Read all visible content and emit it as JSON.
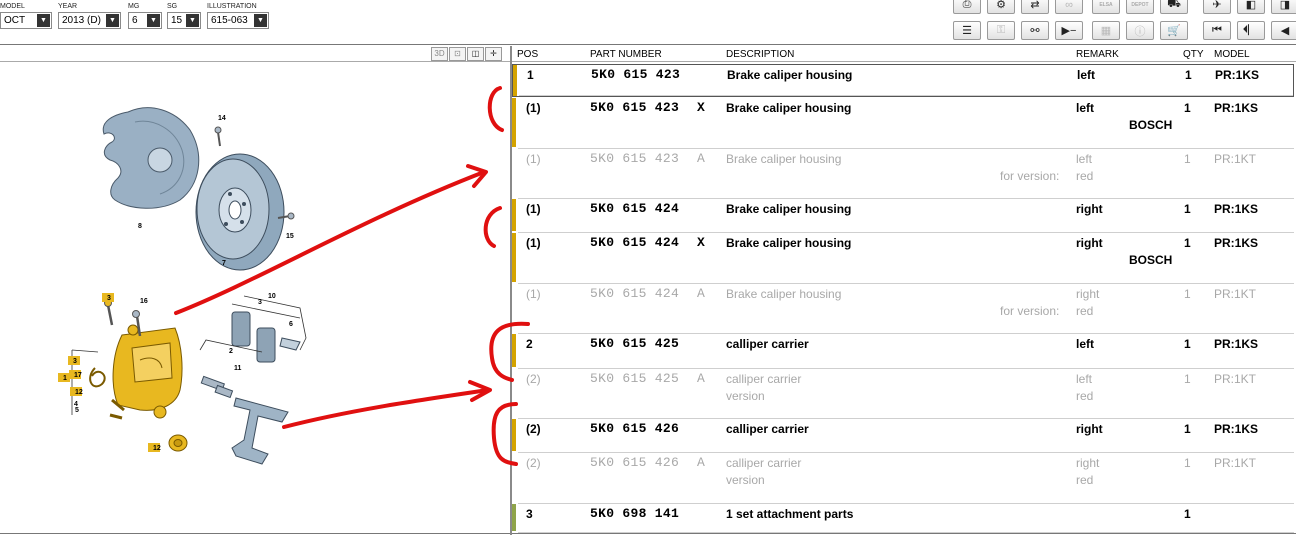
{
  "filters": [
    {
      "label": "MODEL",
      "value": "OCT"
    },
    {
      "label": "YEAR",
      "value": "2013 (D)"
    },
    {
      "label": "MG",
      "value": "6"
    },
    {
      "label": "SG",
      "value": "15"
    },
    {
      "label": "ILLUSTRATION",
      "value": "615-063"
    }
  ],
  "toolbar": {
    "elsa_label": "ELSA",
    "depot_label": "DEPOT"
  },
  "panel_buttons": {
    "three_d": "3D"
  },
  "table": {
    "headers": {
      "pos": "POS",
      "part_number": "PART NUMBER",
      "description": "DESCRIPTION",
      "remark": "REMARK",
      "qty": "QTY",
      "model": "MODEL"
    },
    "rows": [
      {
        "pos": "1",
        "part": "5K0 615 423",
        "suffix": "",
        "desc": "Brake caliper housing",
        "desc2": "",
        "remark": "left",
        "remark2": "",
        "note_label": "",
        "qty": "1",
        "model": "PR:1KS",
        "dim": false,
        "bar": "#d4a300"
      },
      {
        "pos": "(1)",
        "part": "5K0 615 423",
        "suffix": "X",
        "desc": "Brake caliper housing",
        "desc2": "",
        "remark": "left",
        "remark2": "BOSCH",
        "note_label": "",
        "qty": "1",
        "model": "PR:1KS",
        "dim": false,
        "bar": "#d4a300"
      },
      {
        "pos": "(1)",
        "part": "5K0 615 423",
        "suffix": "A",
        "desc": "Brake caliper housing",
        "desc2": "",
        "remark": "left",
        "remark2": "red",
        "note_label": "for version:",
        "qty": "1",
        "model": "PR:1KT",
        "dim": true,
        "bar": ""
      },
      {
        "pos": "(1)",
        "part": "5K0 615 424",
        "suffix": "",
        "desc": "Brake caliper housing",
        "desc2": "",
        "remark": "right",
        "remark2": "",
        "note_label": "",
        "qty": "1",
        "model": "PR:1KS",
        "dim": false,
        "bar": "#d4a300"
      },
      {
        "pos": "(1)",
        "part": "5K0 615 424",
        "suffix": "X",
        "desc": "Brake caliper housing",
        "desc2": "",
        "remark": "right",
        "remark2": "BOSCH",
        "note_label": "",
        "qty": "1",
        "model": "PR:1KS",
        "dim": false,
        "bar": "#d4a300"
      },
      {
        "pos": "(1)",
        "part": "5K0 615 424",
        "suffix": "A",
        "desc": "Brake caliper housing",
        "desc2": "",
        "remark": "right",
        "remark2": "red",
        "note_label": "for version:",
        "qty": "1",
        "model": "PR:1KT",
        "dim": true,
        "bar": ""
      },
      {
        "pos": "2",
        "part": "5K0 615 425",
        "suffix": "",
        "desc": "calliper carrier",
        "desc2": "",
        "remark": "left",
        "remark2": "",
        "note_label": "",
        "qty": "1",
        "model": "PR:1KS",
        "dim": false,
        "bar": "#d4a300"
      },
      {
        "pos": "(2)",
        "part": "5K0 615 425",
        "suffix": "A",
        "desc": "calliper carrier",
        "desc2": "version",
        "remark": "left",
        "remark2": "red",
        "note_label": "",
        "qty": "1",
        "model": "PR:1KT",
        "dim": true,
        "bar": ""
      },
      {
        "pos": "(2)",
        "part": "5K0 615 426",
        "suffix": "",
        "desc": "calliper carrier",
        "desc2": "",
        "remark": "right",
        "remark2": "",
        "note_label": "",
        "qty": "1",
        "model": "PR:1KS",
        "dim": false,
        "bar": "#d4a300"
      },
      {
        "pos": "(2)",
        "part": "5K0 615 426",
        "suffix": "A",
        "desc": "calliper carrier",
        "desc2": "version",
        "remark": "right",
        "remark2": "red",
        "note_label": "",
        "qty": "1",
        "model": "PR:1KT",
        "dim": true,
        "bar": ""
      },
      {
        "pos": "3",
        "part": "5K0 698 141",
        "suffix": "",
        "desc": "1 set attachment parts",
        "desc2": "",
        "remark": "",
        "remark2": "",
        "note_label": "",
        "qty": "1",
        "model": "",
        "dim": false,
        "bar": "#8fa44a"
      }
    ]
  },
  "illustration": {
    "callouts": [
      "14",
      "8",
      "7",
      "15",
      "3",
      "16",
      "10",
      "3",
      "6",
      "2",
      "11",
      "3",
      "17",
      "1",
      "12",
      "4",
      "5",
      "12"
    ]
  },
  "colors": {
    "caliper": "#e8b820",
    "annotation": "#e01010",
    "bar_active": "#d4a300",
    "bar_attachment": "#8fa44a"
  }
}
